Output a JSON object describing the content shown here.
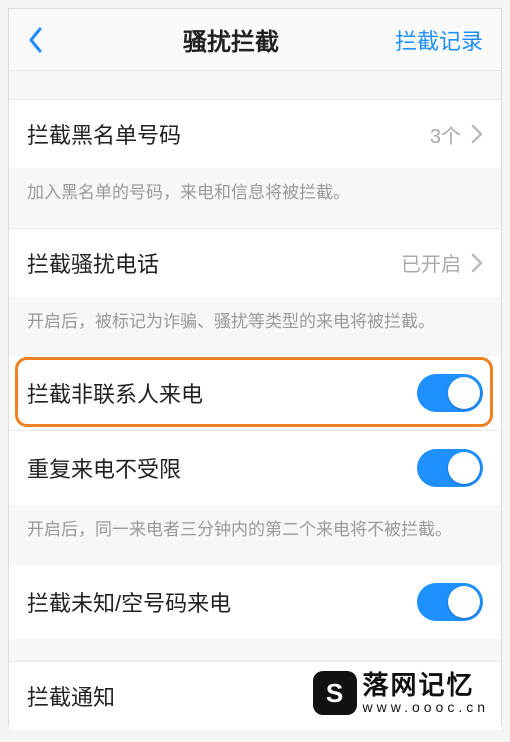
{
  "navbar": {
    "title": "骚扰拦截",
    "right": "拦截记录"
  },
  "rows": {
    "blacklist": {
      "title": "拦截黑名单号码",
      "value": "3个"
    },
    "blacklist_desc": "加入黑名单的号码，来电和信息将被拦截。",
    "harass": {
      "title": "拦截骚扰电话",
      "value": "已开启"
    },
    "harass_desc": "开启后，被标记为诈骗、骚扰等类型的来电将被拦截。",
    "noncontact": {
      "title": "拦截非联系人来电"
    },
    "repeat": {
      "title": "重复来电不受限"
    },
    "repeat_desc": "开启后，同一来电者三分钟内的第二个来电将不被拦截。",
    "unknown": {
      "title": "拦截未知/空号码来电"
    },
    "notify": {
      "title": "拦截通知"
    }
  },
  "watermark": {
    "title": "落网记忆",
    "url": "www.oooc.cn"
  }
}
